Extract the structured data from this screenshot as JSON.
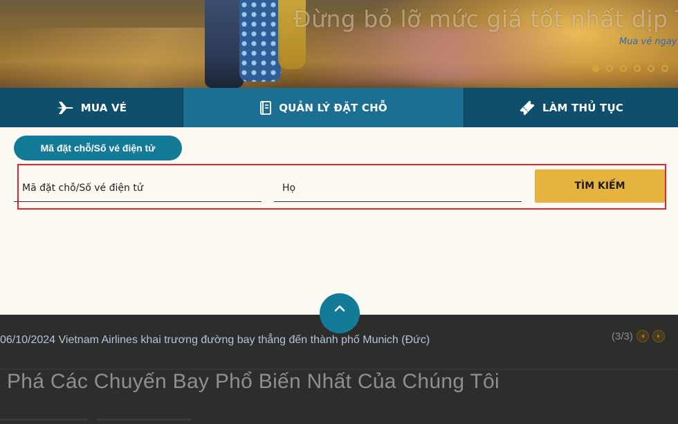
{
  "hero": {
    "tagline": "Đừng bỏ lỡ mức giá tốt nhất dịp Tết",
    "link_text": "Mua vé ngay",
    "carousel_dot_count": 6,
    "active_dot_index": 0
  },
  "tabs": [
    {
      "label": "MUA VÉ",
      "icon": "airplane-icon",
      "active": false
    },
    {
      "label": "QUẢN LÝ ĐẶT CHỖ",
      "icon": "booklet-icon",
      "active": true
    },
    {
      "label": "LÀM THỦ TỤC",
      "icon": "ticket-icon",
      "active": false
    }
  ],
  "manage_booking": {
    "mode_pill_label": "Mã đặt chỗ/Số vé điện tử",
    "booking_code_placeholder": "Mã đặt chỗ/Số vé điện tử",
    "last_name_placeholder": "Họ",
    "search_button_label": "TÌM KIẾM"
  },
  "news": {
    "headline_text": "06/10/2024 Vietnam Airlines khai trương đường bay thẳng đến thành phố Munich (Đức)",
    "pager_count": "(3/3)"
  },
  "section": {
    "heading": "Phá Các Chuyến Bay Phổ Biến Nhất Của Chúng Tôi"
  },
  "colors": {
    "tab_bg": "#0f4f6b",
    "tab_active_bg": "#1a6f92",
    "accent_teal": "#137b98",
    "search_button": "#e4b43f",
    "highlight_border": "#e5232f"
  }
}
